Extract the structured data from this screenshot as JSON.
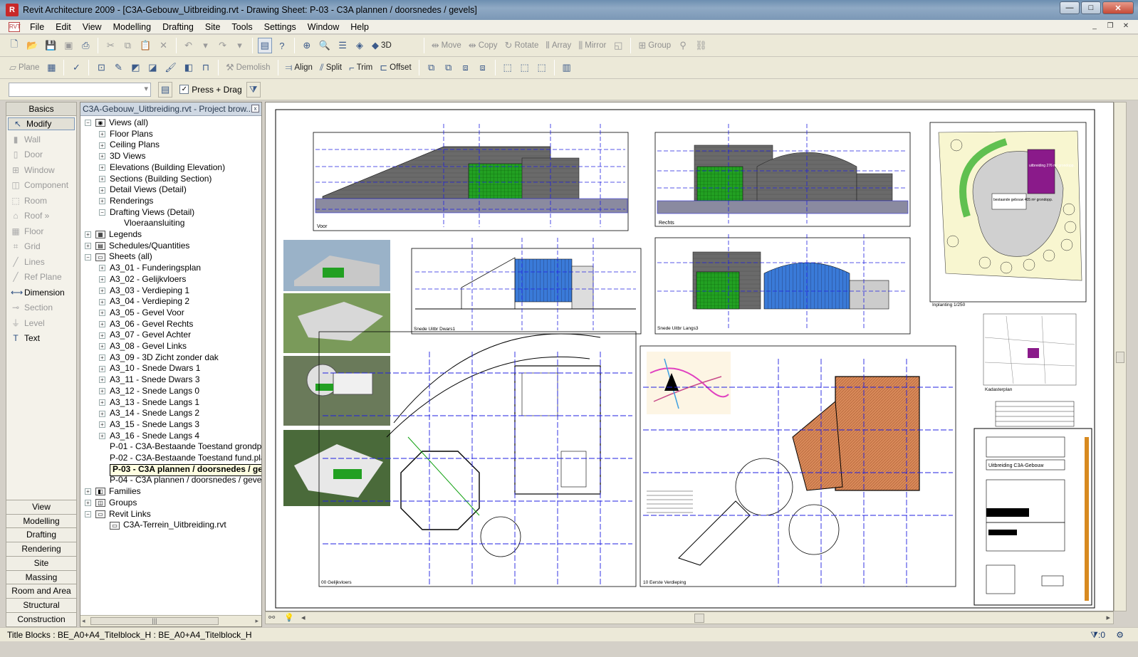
{
  "window": {
    "title": "Revit Architecture 2009 - [C3A-Gebouw_Uitbreiding.rvt - Drawing Sheet: P-03 - C3A plannen / doorsnedes / gevels]",
    "app_icon_label": "R"
  },
  "menu": [
    "File",
    "Edit",
    "View",
    "Modelling",
    "Drafting",
    "Site",
    "Tools",
    "Settings",
    "Window",
    "Help"
  ],
  "toolbar_main": {
    "three_d": "3D",
    "move": "Move",
    "copy": "Copy",
    "rotate": "Rotate",
    "array": "Array",
    "mirror": "Mirror",
    "group": "Group"
  },
  "toolbar_edit": {
    "plane": "Plane",
    "demolish": "Demolish",
    "align": "Align",
    "split": "Split",
    "trim": "Trim",
    "offset": "Offset"
  },
  "options_bar": {
    "press_drag": "Press + Drag",
    "press_drag_checked": true
  },
  "design_bar": {
    "header": "Basics",
    "items": [
      {
        "label": "Modify",
        "icon": "cursor-icon",
        "active": true
      },
      {
        "label": "Wall",
        "icon": "wall-icon",
        "active": false
      },
      {
        "label": "Door",
        "icon": "door-icon",
        "active": false
      },
      {
        "label": "Window",
        "icon": "window-icon",
        "active": false
      },
      {
        "label": "Component",
        "icon": "component-icon",
        "active": false
      },
      {
        "label": "Room",
        "icon": "room-icon",
        "active": false
      },
      {
        "label": "Roof »",
        "icon": "roof-icon",
        "active": false
      },
      {
        "label": "Floor",
        "icon": "floor-icon",
        "active": false
      },
      {
        "label": "Grid",
        "icon": "grid-icon",
        "active": false
      },
      {
        "label": "Lines",
        "icon": "lines-icon",
        "active": false
      },
      {
        "label": "Ref Plane",
        "icon": "ref-plane-icon",
        "active": false
      },
      {
        "label": "Dimension",
        "icon": "dimension-icon",
        "active": true
      },
      {
        "label": "Section",
        "icon": "section-icon",
        "active": false
      },
      {
        "label": "Level",
        "icon": "level-icon",
        "active": false
      },
      {
        "label": "Text",
        "icon": "text-icon",
        "active": true
      }
    ],
    "tabs": [
      "View",
      "Modelling",
      "Drafting",
      "Rendering",
      "Site",
      "Massing",
      "Room and Area",
      "Structural",
      "Construction"
    ]
  },
  "project_browser": {
    "title": "C3A-Gebouw_Uitbreiding.rvt - Project brow...",
    "nodes": [
      {
        "label": "Views (all)",
        "level": 0,
        "exp": "−",
        "icon": "eye"
      },
      {
        "label": "Floor Plans",
        "level": 1,
        "exp": "+"
      },
      {
        "label": "Ceiling Plans",
        "level": 1,
        "exp": "+"
      },
      {
        "label": "3D Views",
        "level": 1,
        "exp": "+"
      },
      {
        "label": "Elevations (Building Elevation)",
        "level": 1,
        "exp": "+"
      },
      {
        "label": "Sections (Building Section)",
        "level": 1,
        "exp": "+"
      },
      {
        "label": "Detail Views (Detail)",
        "level": 1,
        "exp": "+"
      },
      {
        "label": "Renderings",
        "level": 1,
        "exp": "+"
      },
      {
        "label": "Drafting Views (Detail)",
        "level": 1,
        "exp": "−"
      },
      {
        "label": "Vloeraansluiting",
        "level": 2,
        "exp": ""
      },
      {
        "label": "Legends",
        "level": 0,
        "exp": "+",
        "icon": "legend"
      },
      {
        "label": "Schedules/Quantities",
        "level": 0,
        "exp": "+",
        "icon": "table"
      },
      {
        "label": "Sheets (all)",
        "level": 0,
        "exp": "−",
        "icon": "sheet"
      },
      {
        "label": "A3_01 - Funderingsplan",
        "level": 1,
        "exp": "+"
      },
      {
        "label": "A3_02 - Gelijkvloers",
        "level": 1,
        "exp": "+"
      },
      {
        "label": "A3_03 - Verdieping 1",
        "level": 1,
        "exp": "+"
      },
      {
        "label": "A3_04 - Verdieping 2",
        "level": 1,
        "exp": "+"
      },
      {
        "label": "A3_05 - Gevel Voor",
        "level": 1,
        "exp": "+"
      },
      {
        "label": "A3_06 - Gevel Rechts",
        "level": 1,
        "exp": "+"
      },
      {
        "label": "A3_07 - Gevel Achter",
        "level": 1,
        "exp": "+"
      },
      {
        "label": "A3_08 - Gevel Links",
        "level": 1,
        "exp": "+"
      },
      {
        "label": "A3_09 - 3D Zicht zonder dak",
        "level": 1,
        "exp": "+"
      },
      {
        "label": "A3_10 - Snede Dwars 1",
        "level": 1,
        "exp": "+"
      },
      {
        "label": "A3_11 - Snede Dwars 3",
        "level": 1,
        "exp": "+"
      },
      {
        "label": "A3_12 - Snede Langs 0",
        "level": 1,
        "exp": "+"
      },
      {
        "label": "A3_13 - Snede Langs 1",
        "level": 1,
        "exp": "+"
      },
      {
        "label": "A3_14 - Snede Langs 2",
        "level": 1,
        "exp": "+"
      },
      {
        "label": "A3_15 - Snede Langs 3",
        "level": 1,
        "exp": "+"
      },
      {
        "label": "A3_16 - Snede Langs 4",
        "level": 1,
        "exp": "+"
      },
      {
        "label": "P-01 - C3A-Bestaande Toestand grondplan/",
        "level": 1,
        "exp": ""
      },
      {
        "label": "P-02 - C3A-Bestaande Toestand fund.plan/",
        "level": 1,
        "exp": ""
      },
      {
        "label": "P-03 - C3A plannen / doorsnedes / gevels",
        "level": 1,
        "exp": "+",
        "current": true
      },
      {
        "label": "P-04 - C3A plannen / doorsnedes / gevels",
        "level": 1,
        "exp": ""
      },
      {
        "label": "Families",
        "level": 0,
        "exp": "+",
        "icon": "family"
      },
      {
        "label": "Groups",
        "level": 0,
        "exp": "+",
        "icon": "group"
      },
      {
        "label": "Revit Links",
        "level": 0,
        "exp": "−",
        "icon": "link"
      },
      {
        "label": "C3A-Terrein_Uitbreiding.rvt",
        "level": 1,
        "exp": "",
        "icon": "link"
      }
    ]
  },
  "sheet": {
    "view_labels": {
      "voor": "Voor",
      "rechts": "Rechts",
      "snede_dwars": "Snede Uitbr Dwars1",
      "snede_langs": "Snede Uitbr Langs3",
      "inplanting": "Inplanting 1/250",
      "kadaster": "Kadasterplan",
      "gelijkvloers": "00 Gelijkvloers",
      "verdieping": "10 Eerste Verdieping",
      "bestaande": "bestaande gebouw 405 m² grondopp.",
      "uitbreiding": "uitbreiding 276 m² grondopp.",
      "title_block_name": "Uitbreiding C3A-Gebouw"
    }
  },
  "status": {
    "text": "Title Blocks : BE_A0+A4_Titelblock_H : BE_A0+A4_Titelblock_H",
    "filter_count": ":0"
  },
  "colors": {
    "grid_blue": "#2020e0",
    "glass_green": "#20a020",
    "facade_grey": "#6a6a6a"
  }
}
